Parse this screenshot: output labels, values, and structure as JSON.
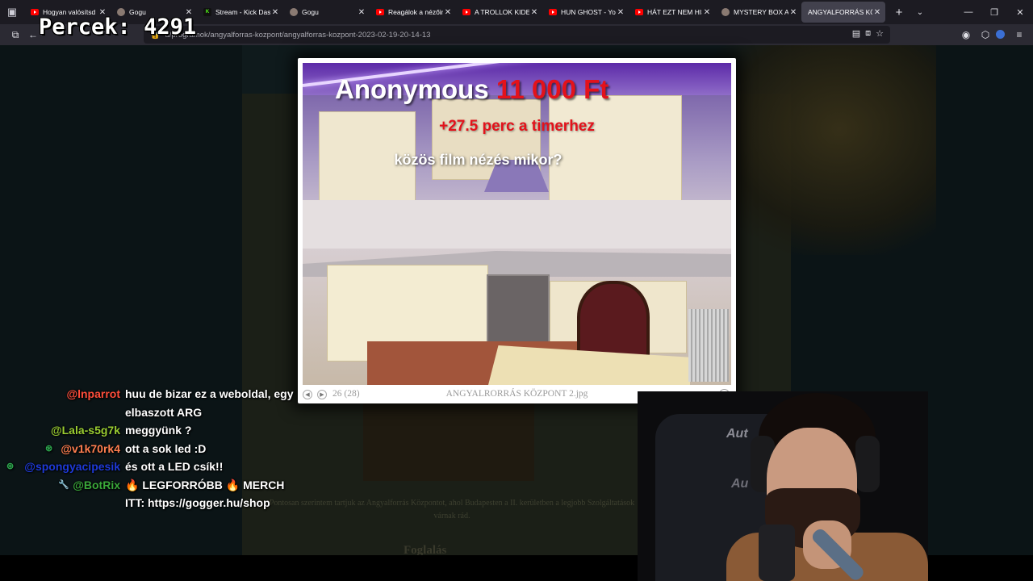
{
  "overlay": {
    "percek_label": "Percek:",
    "percek_value": "4291"
  },
  "browser": {
    "tabs": [
      {
        "title": "Hogyan valósítsd m",
        "favicon": "youtube-icon",
        "active": false
      },
      {
        "title": "Gogu",
        "favicon": "avatar-icon",
        "active": false
      },
      {
        "title": "Stream - Kick Dashb",
        "favicon": "kick-icon",
        "active": false
      },
      {
        "title": "Gogu",
        "favicon": "avatar-icon",
        "active": false
      },
      {
        "title": "Reagálok a nézőim",
        "favicon": "youtube-icon",
        "active": false
      },
      {
        "title": "A TROLLOK KIDERÍ",
        "favicon": "youtube-icon",
        "active": false
      },
      {
        "title": "HUN GHOST - YouT",
        "favicon": "youtube-icon",
        "active": false
      },
      {
        "title": "HÁT EZT NEM HISZ",
        "favicon": "youtube-icon",
        "active": false
      },
      {
        "title": "MYSTERY BOX Arch",
        "favicon": "avatar-icon",
        "active": false
      },
      {
        "title": "ANGYALFORRÁS KÖZPO",
        "favicon": "none",
        "active": true
      }
    ],
    "url": "u/programok/angyalforras-kozpont/angyalforras-kozpont-2023-02-19-20-14-13"
  },
  "lightbox": {
    "counter": "26 (28)",
    "caption": "ANGYALRORRÁS KÖZPONT 2.jpg"
  },
  "donation": {
    "name": "Anonymous",
    "amount": "11 000 Ft",
    "timer": "+27.5 perc a timerhez",
    "message": "közös film nézés mikor?"
  },
  "chat": [
    {
      "user": "@lnparrot",
      "color": "#ff4e3b",
      "badge": "",
      "message": "huu de bizar ez a weboldal, egy elbaszott ARG"
    },
    {
      "user": "@Lala-s5g7k",
      "color": "#9acd32",
      "badge": "",
      "message": "meggyünk ?"
    },
    {
      "user": "@v1k70rk4",
      "color": "#ff7f50",
      "badge": "kick-icon",
      "message": "ott a sok led :D"
    },
    {
      "user": "@spongyacipesik",
      "color": "#1e3ad8",
      "badge": "kick-icon",
      "message": "és ott a LED csík!!"
    },
    {
      "user": "@BotRix",
      "color": "#3aa83a",
      "badge": "wrench-icon",
      "message": "🔥 LEGFORRÓBB 🔥 MERCH ITT: https://gogger.hu/shop"
    }
  ],
  "page_bg": {
    "paragraph": "Pontosan szerintem tartjuk az Angyalforrás Központot, ahol Budapesten a II. kerületben a legjobb Szolgáltatások várnak rád.",
    "heading": "Foglalás"
  },
  "webcam": {
    "chair_text_1": "Aut",
    "chair_text_2": "Au"
  }
}
